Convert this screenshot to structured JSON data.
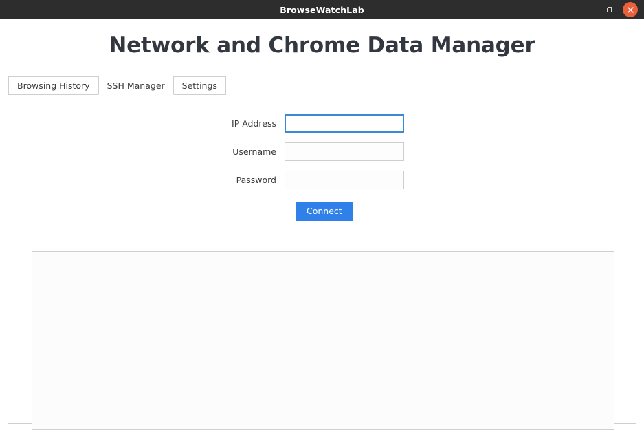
{
  "window": {
    "title": "BrowseWatchLab",
    "controls": {
      "minimize_label": "Minimize",
      "maximize_label": "Restore",
      "close_label": "Close"
    },
    "colors": {
      "titlebar_bg": "#2d2d2d",
      "close_bg": "#e8603c",
      "accent": "#2f80e8",
      "focus_border": "#3a8ad8",
      "border": "#cfcfcf",
      "heading_text": "#333840"
    }
  },
  "header": {
    "title": "Network and Chrome Data Manager"
  },
  "tabs": [
    {
      "label": "Browsing History",
      "active": false
    },
    {
      "label": "SSH Manager",
      "active": true
    },
    {
      "label": "Settings",
      "active": false
    }
  ],
  "ssh_manager": {
    "fields": [
      {
        "label": "IP Address",
        "value": "",
        "placeholder": "",
        "focused": true
      },
      {
        "label": "Username",
        "value": "",
        "placeholder": "",
        "focused": false
      },
      {
        "label": "Password",
        "value": "",
        "placeholder": "",
        "focused": false
      }
    ],
    "connect_button_label": "Connect",
    "output": ""
  }
}
